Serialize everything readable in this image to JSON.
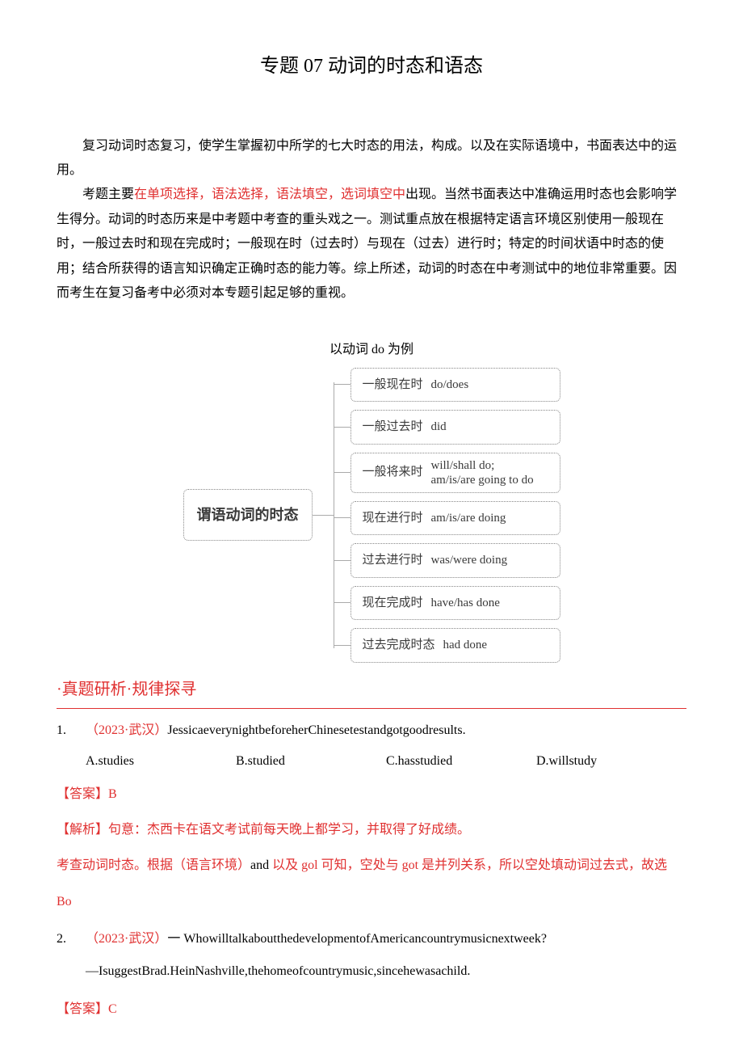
{
  "title": "专题 07 动词的时态和语态",
  "intro": {
    "p1": "复习动词时态复习，使学生掌握初中所学的七大时态的用法，构成。以及在实际语境中，书面表达中的运用。",
    "p2a": "考题主要",
    "p2red": "在单项选择，语法选择，语法填空，选词填空中",
    "p2b": "出现。当然书面表达中准确运用时态也会影响学生得分。动词的时态历来是中考题中考查的重头戏之一。测试重点放在根据特定语言环境区别使用一般现在时，一般过去时和现在完成时；一般现在时（过去时）与现在（过去）进行时；特定的时间状语中时态的使用；结合所获得的语言知识确定正确时态的能力等。综上所述，动词的时态在中考测试中的地位非常重要。因而考生在复习备考中必须对本专题引起足够的重视。"
  },
  "diagram": {
    "caption": "以动词 do 为例",
    "root": "谓语动词的时态",
    "leaves": [
      {
        "label": "一般现在时",
        "form": "do/does"
      },
      {
        "label": "一般过去时",
        "form": "did"
      },
      {
        "label": "一般将来时",
        "form": "will/shall do;",
        "form2": "am/is/are going to do"
      },
      {
        "label": "现在进行时",
        "form": "am/is/are doing"
      },
      {
        "label": "过去进行时",
        "form": "was/were doing"
      },
      {
        "label": "现在完成时",
        "form": "have/has done"
      },
      {
        "label": "过去完成时态",
        "form": "had done"
      }
    ]
  },
  "section_header": "·真题研析·规律探寻",
  "q1": {
    "num": "1.",
    "year": "（2023·武汉）",
    "stem": "JessicaeverynightbeforeherChinesetestandgotgoodresults.",
    "opts": {
      "a": "A.studies",
      "b": "B.studied",
      "c": "C.hasstudied",
      "d": "D.willstudy"
    },
    "answer": "【答案】B",
    "analysis1": "【解析】句意：杰西卡在语文考试前每天晚上都学习，并取得了好成绩。",
    "analysis2a": "考查动词时态。根据（语言环境）",
    "analysis2and": "and",
    "analysis2b": " 以及 gol 可知，空处与 got 是并列关系，所以空处填动词过去式，故选",
    "analysis3": "Bo"
  },
  "q2": {
    "num": "2.",
    "year": "（2023·武汉）",
    "stem": "一 WhowilltalkaboutthedevelopmentofAmericancountrymusicnextweek?",
    "line2": "—IsuggestBrad.HeinNashville,thehomeofcountrymusic,sincehewasachild.",
    "answer": "【答案】C"
  }
}
